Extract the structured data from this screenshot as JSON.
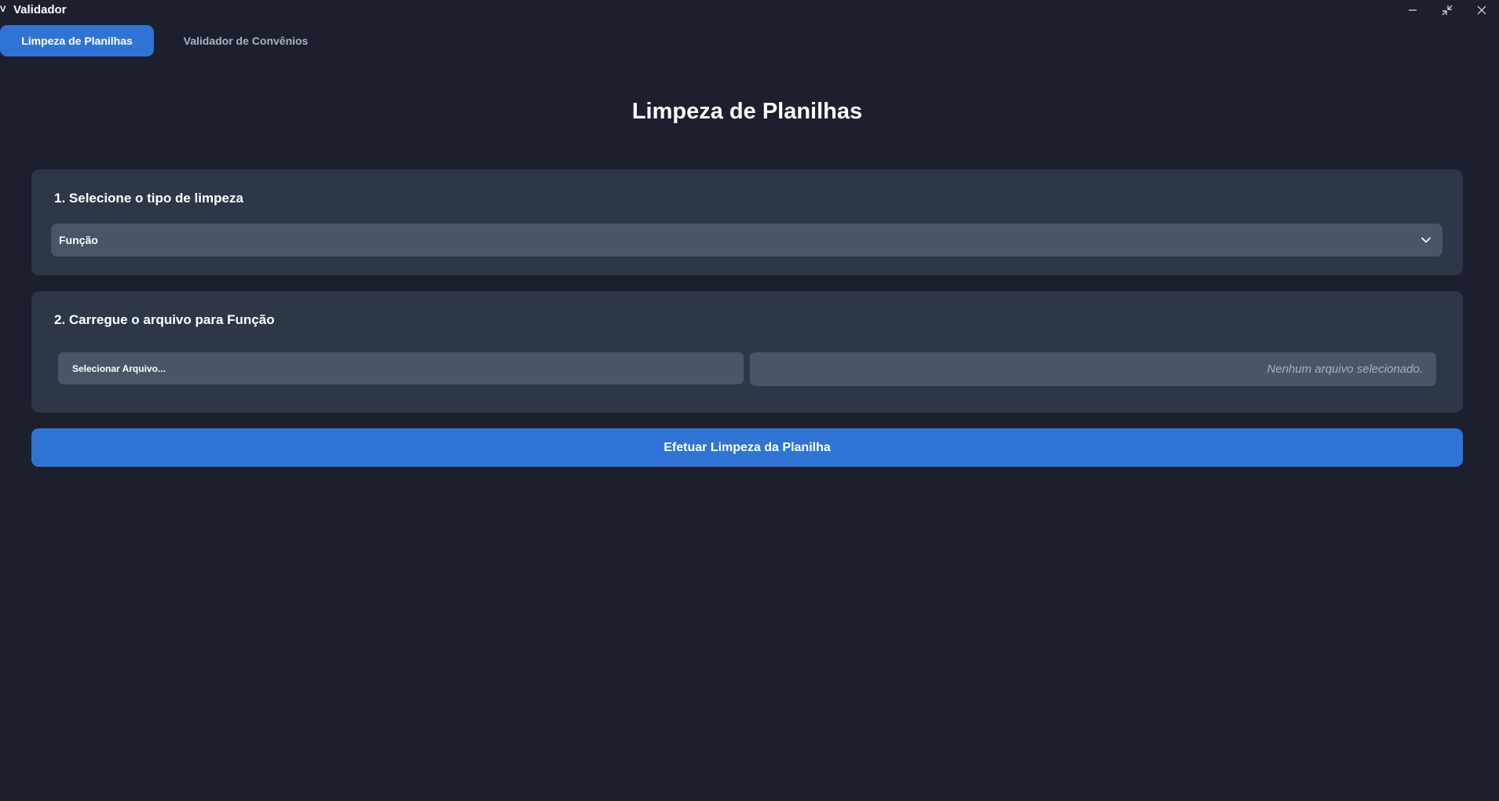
{
  "window": {
    "app_icon_glyph": "V",
    "title": "Validador",
    "controls": [
      "minimize-icon",
      "restore-icon",
      "close-icon"
    ]
  },
  "tabs": [
    {
      "label": "Limpeza de Planilhas",
      "active": true
    },
    {
      "label": "Validador de Convênios",
      "active": false
    }
  ],
  "main": {
    "title": "Limpeza de Planilhas",
    "step1": {
      "heading": "1. Selecione o tipo de limpeza",
      "select_value": "Função"
    },
    "step2": {
      "heading": "2. Carregue o arquivo para Função",
      "file_button_label": "Selecionar Arquivo...",
      "file_status": "Nenhum arquivo selecionado."
    },
    "submit_label": "Efetuar Limpeza da Planilha"
  },
  "colors": {
    "background": "#1b202c",
    "card": "#2d3748",
    "input": "#4a5568",
    "accent": "#2f74d4"
  }
}
